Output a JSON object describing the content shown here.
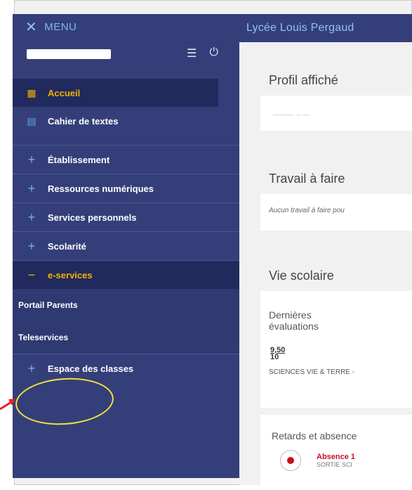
{
  "menu": {
    "close_icon": "x-icon",
    "label": "MENU"
  },
  "user": {
    "settings_icon": "sliders-icon",
    "power_icon": "power-icon"
  },
  "sidebar": {
    "items": [
      {
        "label": "Accueil",
        "icon": "grid-icon",
        "active": true
      },
      {
        "label": "Cahier de textes",
        "icon": "notebook-icon"
      },
      {
        "label": "Établissement",
        "icon": "plus-icon"
      },
      {
        "label": "Ressources numériques",
        "icon": "plus-icon"
      },
      {
        "label": "Services personnels",
        "icon": "plus-icon"
      },
      {
        "label": "Scolarité",
        "icon": "plus-icon"
      },
      {
        "label": "e-services",
        "icon": "minus-icon",
        "open": true
      },
      {
        "label": "Espace des classes",
        "icon": "plus-icon"
      }
    ],
    "subitems": [
      "Portail Parents",
      "Teleservices"
    ]
  },
  "header": {
    "title": "Lycée Louis Pergaud"
  },
  "main": {
    "profil_heading": "Profil affiché",
    "travail_heading": "Travail à faire",
    "travail_text": "Aucun travail à faire pou",
    "vie_heading": "Vie scolaire",
    "evaluations_label": "Dernières évaluations",
    "grade_num": "9,50",
    "grade_den": "10",
    "subject": "SCIENCES VIE & TERRE -",
    "retards_label": "Retards et absence",
    "absence_title": "Absence 1",
    "absence_sub": "SORTIE SCI"
  },
  "colors": {
    "sidebar": "#343f7a",
    "active_bg": "#212a5c",
    "accent": "#f1b300",
    "highlight": "#f3e23c",
    "arrow": "#e8211c"
  }
}
